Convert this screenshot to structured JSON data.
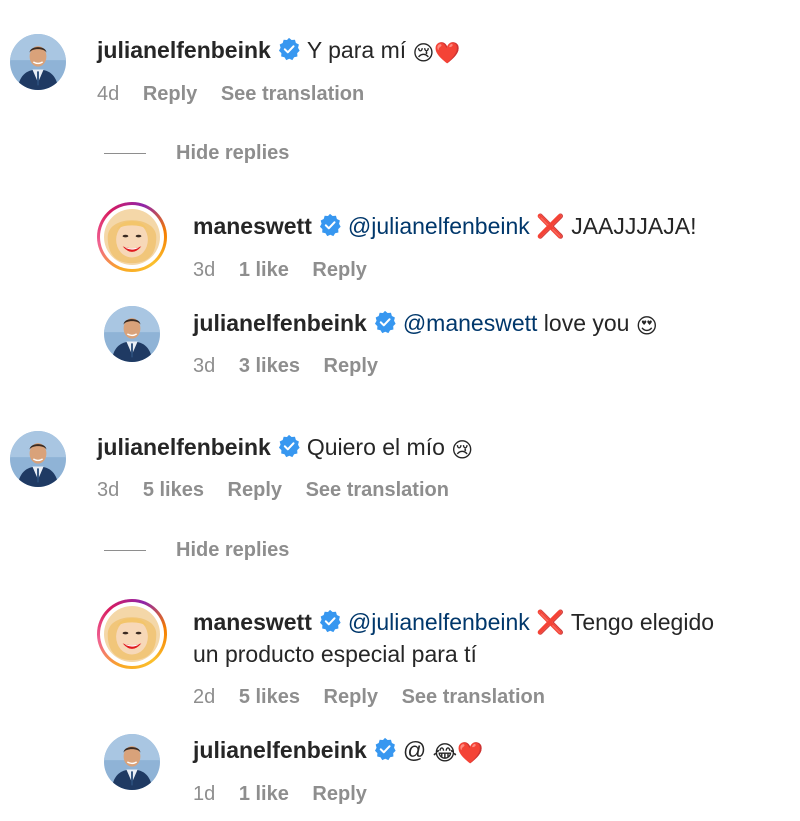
{
  "comments": [
    {
      "user": "julianelfenbeink",
      "text": "Y para mí",
      "emoji": [
        "😢",
        "❤️"
      ],
      "time": "4d",
      "reply_label": "Reply",
      "translate_label": "See translation",
      "hide_replies": "Hide replies",
      "replies": [
        {
          "user": "maneswett",
          "mention": "@julianelfenbeink",
          "cross": "❌",
          "text": "JAAJJJAJA!",
          "time": "3d",
          "likes": "1 like",
          "reply_label": "Reply"
        },
        {
          "user": "julianelfenbeink",
          "mention": "@maneswett",
          "text": "love you",
          "emoji": "😍",
          "time": "3d",
          "likes": "3 likes",
          "reply_label": "Reply"
        }
      ]
    },
    {
      "user": "julianelfenbeink",
      "text": "Quiero el mío",
      "emoji": "😢",
      "time": "3d",
      "likes": "5 likes",
      "reply_label": "Reply",
      "translate_label": "See translation",
      "hide_replies": "Hide replies",
      "replies": [
        {
          "user": "maneswett",
          "mention": "@julianelfenbeink",
          "cross": "❌",
          "text_line1": "Tengo elegido",
          "text_line2": "un producto especial para tí",
          "time": "2d",
          "likes": "5 likes",
          "reply_label": "Reply",
          "translate_label": "See translation"
        },
        {
          "user": "julianelfenbeink",
          "text": "@",
          "emoji": [
            "😂",
            "❤️"
          ],
          "time": "1d",
          "likes": "1 like",
          "reply_label": "Reply"
        }
      ]
    }
  ],
  "colors": {
    "mention": "#00376b",
    "meta": "#8e8e8e",
    "verified": "#3797f0"
  }
}
